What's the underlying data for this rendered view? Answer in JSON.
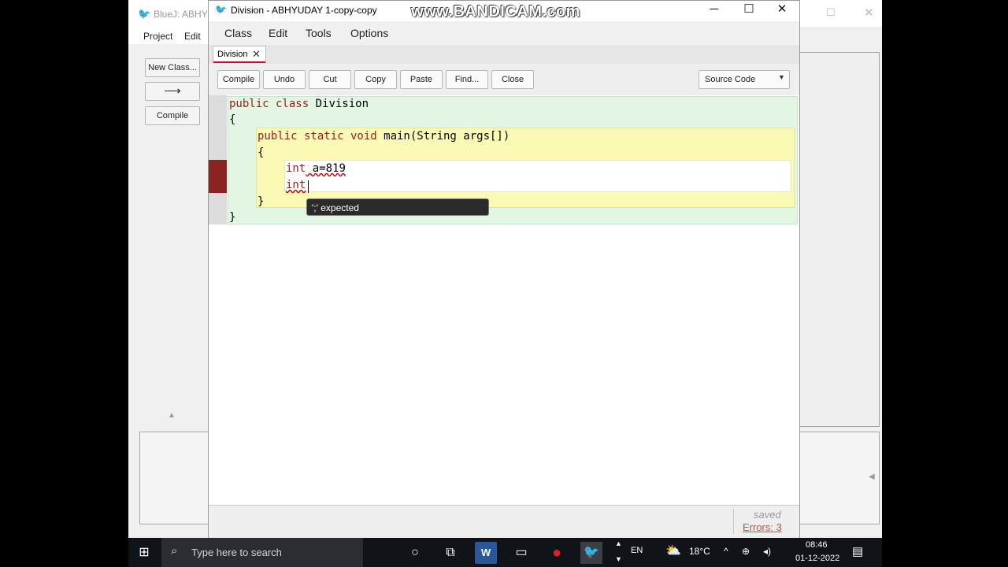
{
  "watermark": "www.BANDICAM.com",
  "bluej": {
    "title": "BlueJ: ABHYU",
    "menu": [
      "Project",
      "Edit"
    ],
    "buttons": {
      "new_class": "New Class...",
      "compile": "Compile"
    }
  },
  "editor": {
    "title": "Division - ABHYUDAY 1-copy-copy",
    "menu": [
      "Class",
      "Edit",
      "Tools",
      "Options"
    ],
    "tab": {
      "label": "Division"
    },
    "toolbar": [
      "Compile",
      "Undo",
      "Cut",
      "Copy",
      "Paste",
      "Find...",
      "Close"
    ],
    "view_selector": "Source Code",
    "code": {
      "line1_kw": "public class",
      "line1_rest": " Division",
      "line2": "{",
      "line3_kw": "public static void",
      "line3_rest": " main(String args[])",
      "line4": "{",
      "line5_kw": "int",
      "line5_rest": " a=819",
      "line6_kw": "int",
      "line7": "}",
      "line8": "}"
    },
    "tooltip": "';' expected",
    "status": {
      "saved": "saved",
      "errors": "Errors: 3"
    }
  },
  "taskbar": {
    "search_placeholder": "Type here to search",
    "language": "EN",
    "weather": "18°C",
    "time": "08:46",
    "date": "01-12-2022"
  },
  "colors": {
    "keyword": "#9b1c1c",
    "error_gutter": "#8b2323",
    "class_scope": "#e3f5e3",
    "method_scope": "#fafab4"
  }
}
